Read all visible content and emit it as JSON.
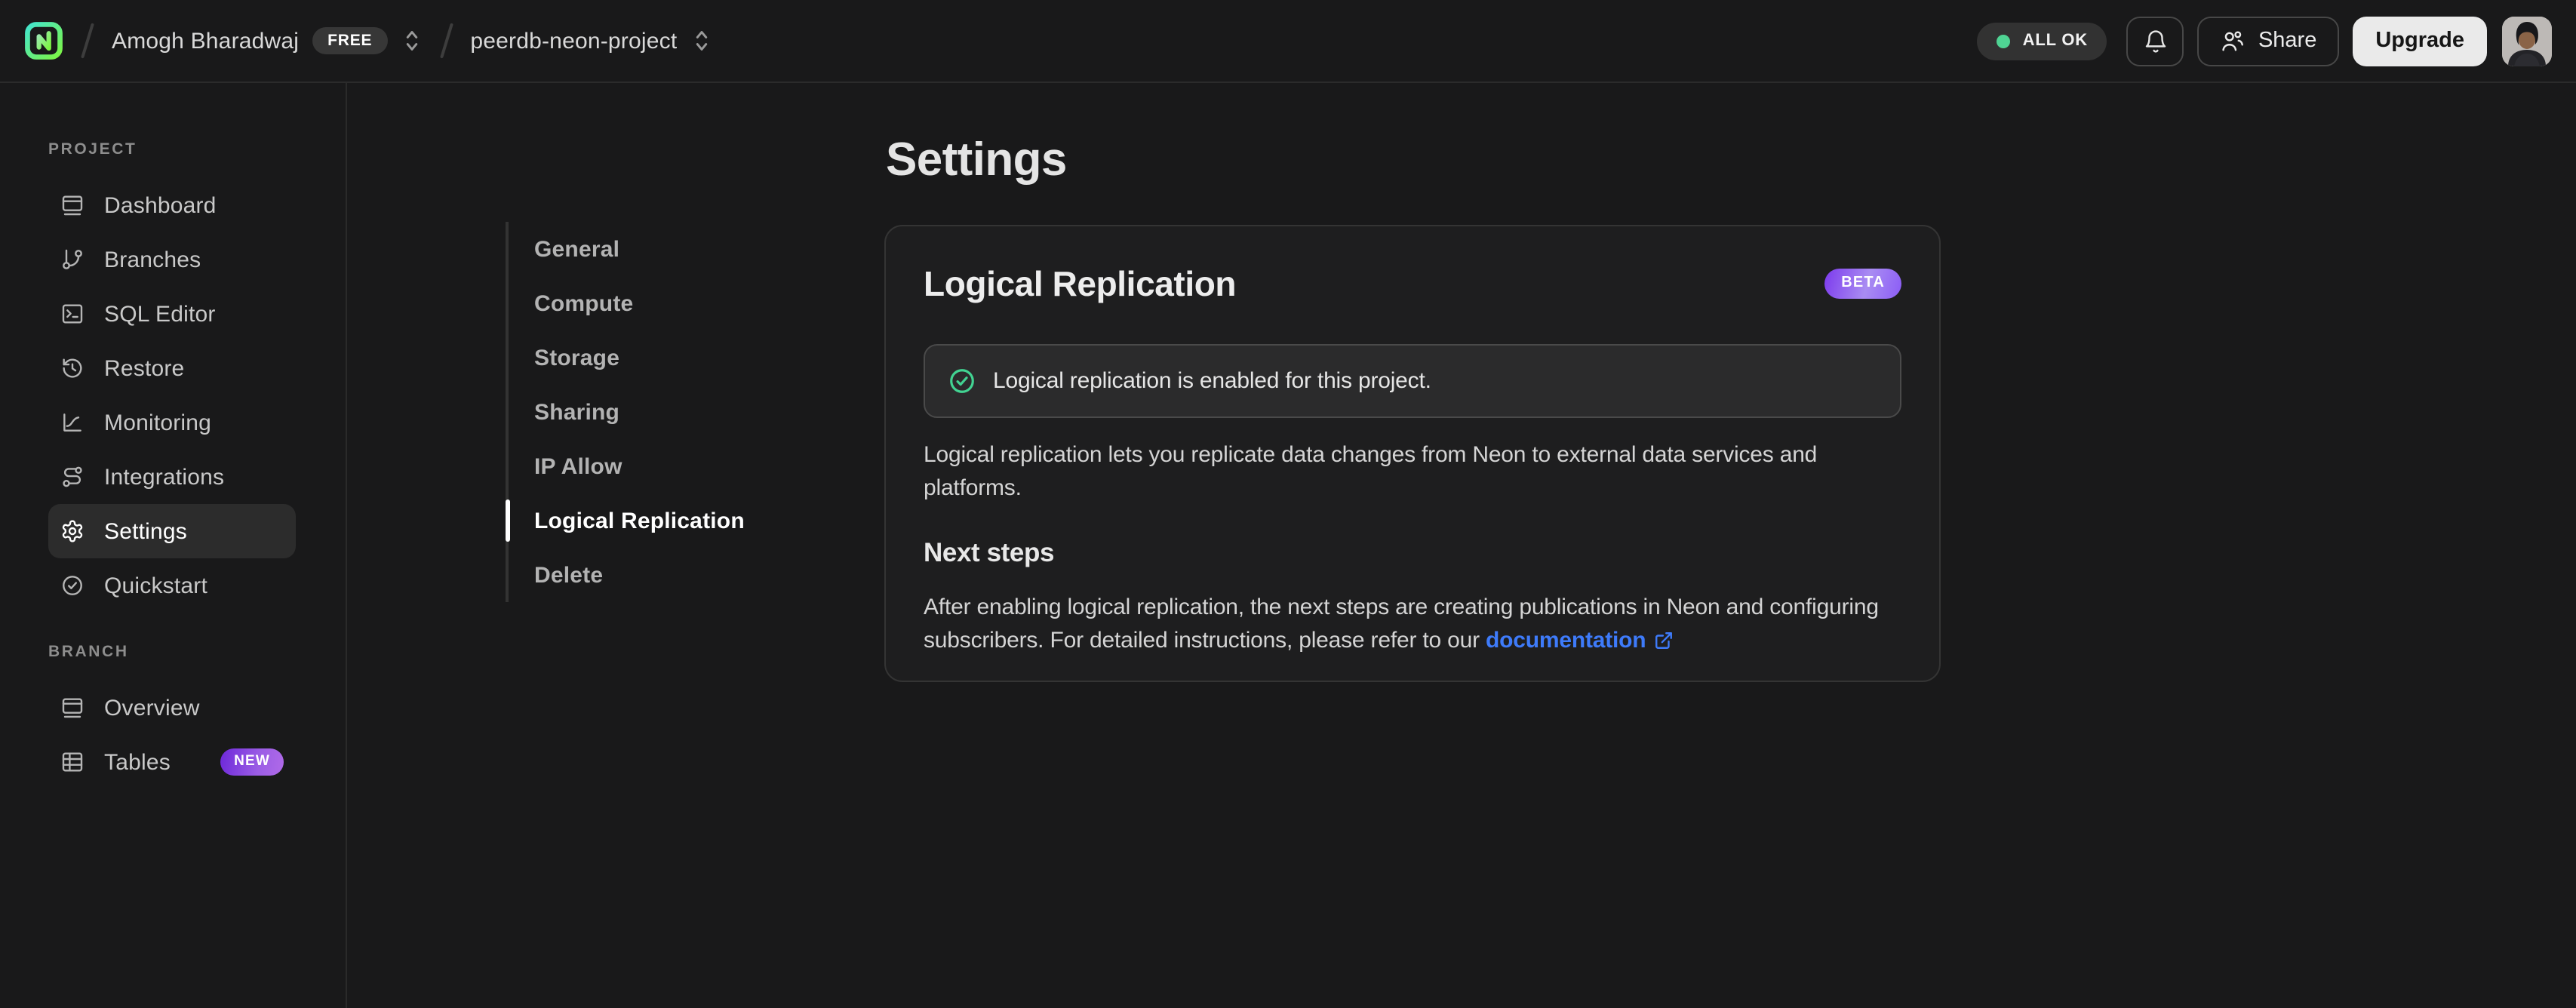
{
  "header": {
    "org_name": "Amogh Bharadwaj",
    "org_plan_badge": "FREE",
    "project_name": "peerdb-neon-project",
    "status_badge": "ALL OK",
    "share_label": "Share",
    "upgrade_label": "Upgrade"
  },
  "sidebar": {
    "project_section_label": "PROJECT",
    "project_items": [
      {
        "label": "Dashboard"
      },
      {
        "label": "Branches"
      },
      {
        "label": "SQL Editor"
      },
      {
        "label": "Restore"
      },
      {
        "label": "Monitoring"
      },
      {
        "label": "Integrations"
      },
      {
        "label": "Settings",
        "active": true
      },
      {
        "label": "Quickstart"
      }
    ],
    "branch_section_label": "BRANCH",
    "branch_items": [
      {
        "label": "Overview"
      },
      {
        "label": "Tables",
        "badge": "NEW"
      }
    ]
  },
  "settings_nav": {
    "items": [
      {
        "label": "General"
      },
      {
        "label": "Compute"
      },
      {
        "label": "Storage"
      },
      {
        "label": "Sharing"
      },
      {
        "label": "IP Allow"
      },
      {
        "label": "Logical Replication",
        "active": true
      },
      {
        "label": "Delete"
      }
    ]
  },
  "main": {
    "page_title": "Settings",
    "card": {
      "title": "Logical Replication",
      "beta_badge": "BETA",
      "banner_text": "Logical replication is enabled for this project.",
      "description": "Logical replication lets you replicate data changes from Neon to external data services and platforms.",
      "next_steps_title": "Next steps",
      "next_steps_text": "After enabling logical replication, the next steps are creating publications in Neon and configuring subscribers. For detailed instructions, please refer to our ",
      "documentation_link_label": "documentation"
    }
  },
  "colors": {
    "success_green": "#42d392",
    "beta_purple": "#8b5cf6",
    "link_blue": "#3e7bfa",
    "logo_teal": "#43e5ce",
    "logo_green": "#7df543"
  }
}
